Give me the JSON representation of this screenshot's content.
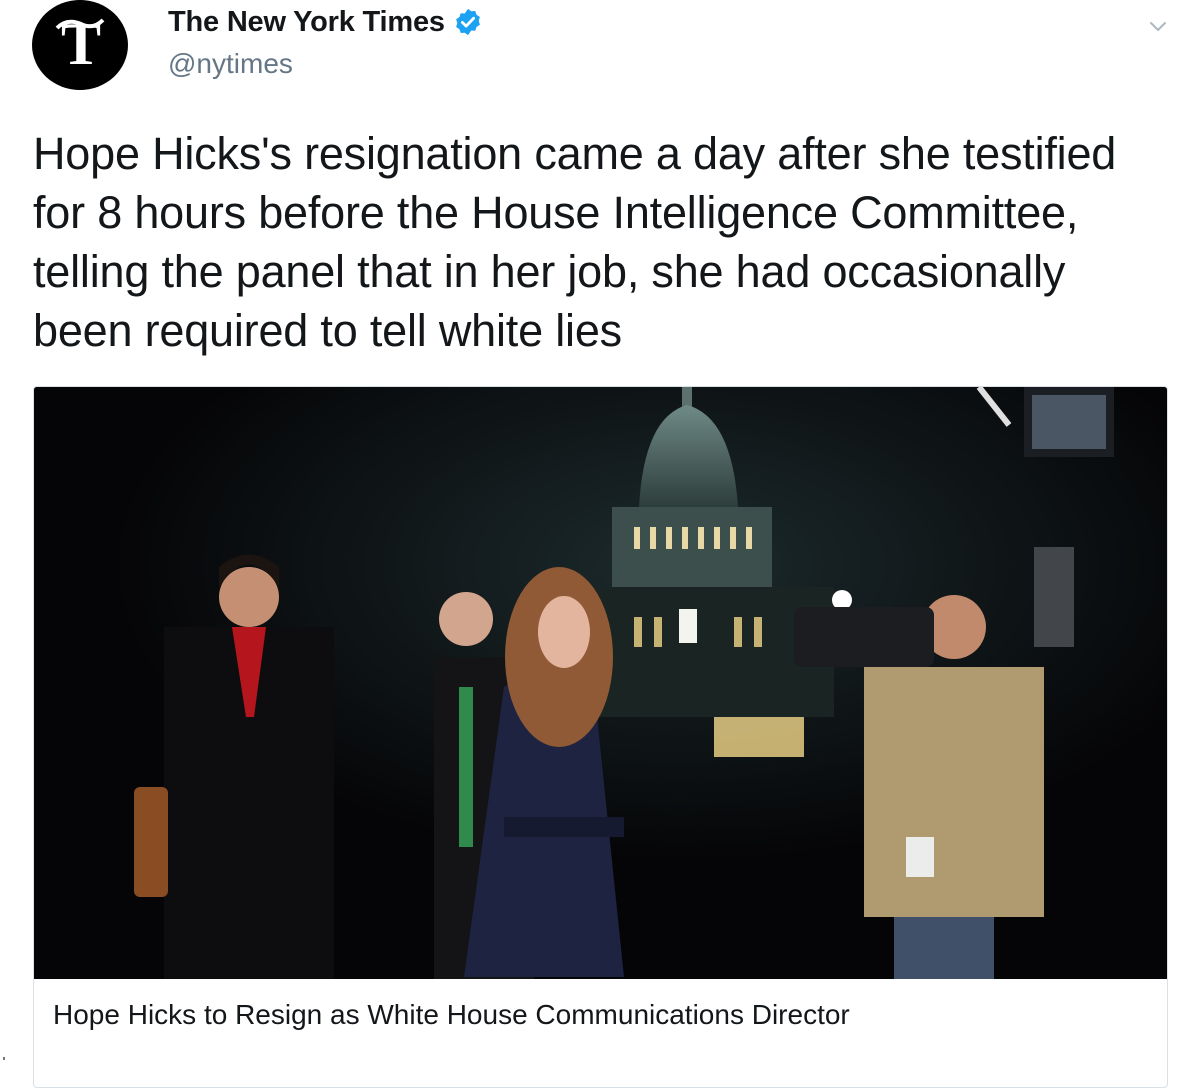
{
  "tweet": {
    "display_name": "The New York Times",
    "handle": "@nytimes",
    "verified": true,
    "text": "Hope Hicks's resignation came a day after she testified for 8 hours before the House Intelligence Committee, telling the panel that in her job, she had occasionally been required to tell white lies",
    "avatar_icon": "nyt-logo-icon",
    "menu_icon": "chevron-down-icon"
  },
  "card": {
    "title": "Hope Hicks to Resign as White House Communications Director",
    "image": "photo-night-capitol-walk"
  },
  "colors": {
    "verified_blue": "#1da1f2",
    "handle_gray": "#657786",
    "text": "#14171a",
    "card_border": "#d9e0e6"
  }
}
